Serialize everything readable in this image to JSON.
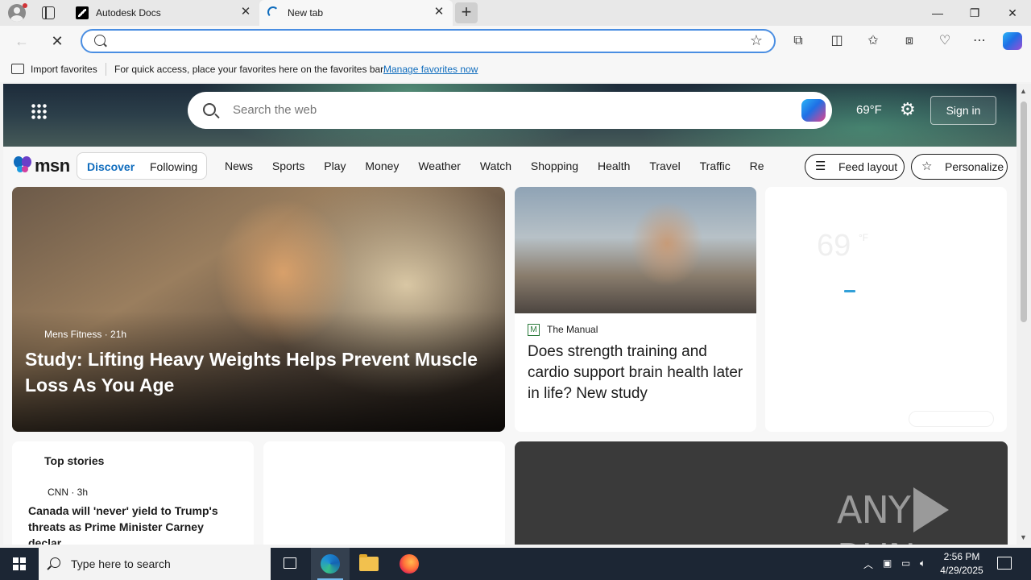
{
  "browser": {
    "tabs": [
      {
        "title": "Autodesk Docs",
        "favicon": "autodesk-icon"
      },
      {
        "title": "New tab",
        "favicon": "loading-spinner-icon"
      }
    ],
    "new_tab_symbol": "+",
    "address": {
      "value": "",
      "placeholder": ""
    },
    "favorites_bar": {
      "import_label": "Import favorites",
      "message": "For quick access, place your favorites here on the favorites bar.",
      "link": "Manage favorites now"
    }
  },
  "msn": {
    "search_placeholder": "Search the web",
    "weather": "69°F",
    "sign_in": "Sign in",
    "logo_text": "msn",
    "feed_tabs": {
      "discover": "Discover",
      "following": "Following"
    },
    "nav": [
      "News",
      "Sports",
      "Play",
      "Money",
      "Weather",
      "Watch",
      "Shopping",
      "Health",
      "Travel",
      "Traffic",
      "Real Estate"
    ],
    "feed_layout": "Feed layout",
    "personalize": "Personalize",
    "hero_card": {
      "source": "Mens Fitness · 21h",
      "headline": "Study: Lifting Heavy Weights Helps Prevent Muscle Loss As You Age"
    },
    "manual_card": {
      "publisher": "The Manual",
      "publisher_icon": "M",
      "headline": "Does strength training and cardio support brain health later in life? New study"
    },
    "weather_card": {
      "temp": "69",
      "unit": "°F"
    },
    "top_stories": {
      "heading": "Top stories",
      "source": "CNN · 3h",
      "headline": "Canada will 'never' yield to Trump's threats as Prime Minister Carney declar..."
    },
    "watermark": {
      "left": "ANY",
      "right": "RUN"
    }
  },
  "taskbar": {
    "search_placeholder": "Type here to search",
    "time": "2:56 PM",
    "date": "4/29/2025"
  },
  "colors": {
    "accent": "#0f6cbd",
    "taskbar": "#1c2634",
    "omnibox_border": "#4a8ee2"
  }
}
